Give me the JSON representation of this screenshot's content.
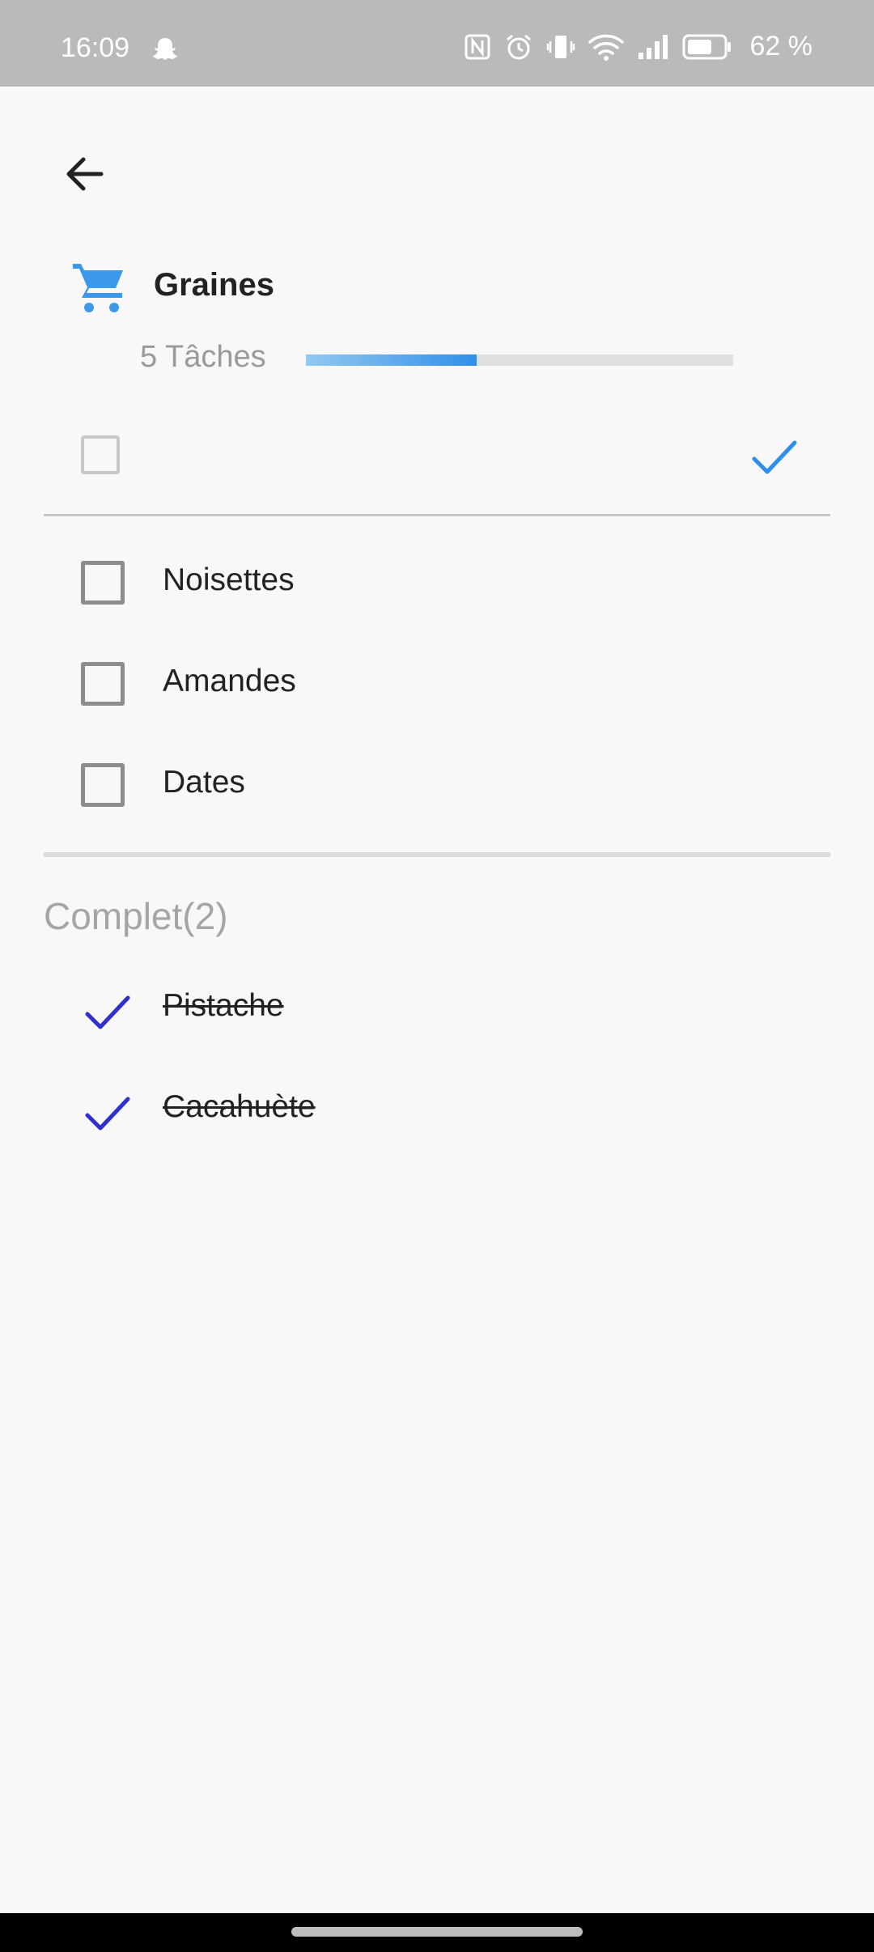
{
  "status_bar": {
    "time": "16:09",
    "battery": "62 %",
    "icons": [
      "snapchat-icon",
      "nfc-icon",
      "alarm-icon",
      "vibrate-icon",
      "wifi-icon",
      "signal-icon",
      "battery-icon"
    ]
  },
  "header": {
    "back_icon": "arrow-left-icon",
    "list_icon": "shopping-cart-icon",
    "title": "Graines",
    "task_count": "5 Tâches",
    "progress": 0.4,
    "accent_color": "#2f8fea"
  },
  "new_item": {
    "placeholder": "",
    "value": "",
    "confirm_icon": "check-icon"
  },
  "todo_items": [
    {
      "label": "Noisettes"
    },
    {
      "label": "Amandes"
    },
    {
      "label": "Dates"
    }
  ],
  "completed": {
    "heading": "Complet(2)",
    "check_color": "#3030d0",
    "items": [
      {
        "label": "Pistache"
      },
      {
        "label": "Cacahuète"
      }
    ]
  }
}
